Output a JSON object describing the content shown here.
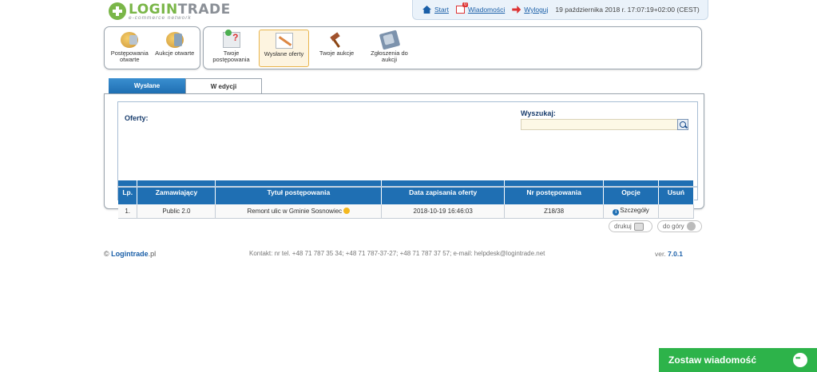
{
  "logo": {
    "word_part1": "LOGIN",
    "word_part2": "TRADE",
    "tagline": "e-commerce network"
  },
  "topbar": {
    "start": "Start",
    "messages": "Wiadomości",
    "messages_count": "0",
    "logout": "Wyloguj",
    "datetime": "19 października 2018 r. 17:07:19+02:00 (CEST)"
  },
  "nav_left": [
    {
      "label": "Postępowania otwarte",
      "icon": "procedures-icon"
    },
    {
      "label": "Aukcje otwarte",
      "icon": "auction-icon"
    }
  ],
  "nav_right": [
    {
      "label": "Twoje postępowania",
      "icon": "your-procedures-icon"
    },
    {
      "label": "Wysłane oferty",
      "icon": "sent-offers-icon",
      "active": true
    },
    {
      "label": "Twoje aukcje",
      "icon": "gavel-icon"
    },
    {
      "label": "Zgłoszenia do aukcji",
      "icon": "auction-entries-icon"
    }
  ],
  "tabs": {
    "sent": "Wysłane",
    "editing": "W edycji"
  },
  "main": {
    "offers_label": "Oferty:",
    "search_label": "Wyszukaj:",
    "search_value": ""
  },
  "table": {
    "headers": [
      "Lp.",
      "Zamawiający",
      "Tytuł postępowania",
      "Data zapisania oferty",
      "Nr postępowania",
      "Opcje",
      "Usuń"
    ],
    "rows": [
      [
        "1.",
        "Public 2.0",
        "Remont ulic w Gminie Sosnowiec",
        "2018-10-19 16:46:03",
        "Z18/38",
        "Szczegóły",
        ""
      ]
    ]
  },
  "footer_buttons": {
    "print": "drukuj",
    "top": "do góry"
  },
  "footer": {
    "copyright": "©",
    "brand": "Logintrade",
    "brand_suffix": ".pl",
    "contact": "Kontakt: nr tel. +48 71 787 35 34; +48 71 787-37-27; +48 71 787 37 57; e-mail: helpdesk@logintrade.net",
    "version_label": "ver.",
    "version": "7.0.1"
  },
  "chat": {
    "label": "Zostaw wiadomość"
  },
  "colors": {
    "accent": "#1f6fb3",
    "brand_green": "#7ab648",
    "chat_green": "#2db34a"
  }
}
